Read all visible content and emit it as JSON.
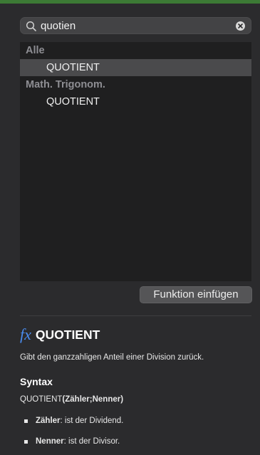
{
  "search": {
    "value": "quotien"
  },
  "results": {
    "groups": [
      {
        "category": "Alle",
        "items": [
          "QUOTIENT"
        ]
      },
      {
        "category": "Math. Trigonom.",
        "items": [
          "QUOTIENT"
        ]
      }
    ],
    "selected": "Alle/QUOTIENT"
  },
  "insert_button": {
    "label": "Funktion einfügen"
  },
  "help": {
    "fx_symbol": "fx",
    "function_name": "QUOTIENT",
    "description": "Gibt den ganzzahligen Anteil einer Division zurück.",
    "syntax_heading": "Syntax",
    "syntax_func": "QUOTIENT",
    "syntax_args": "(Zähler;Nenner)",
    "params": [
      {
        "name": "Zähler",
        "text": ": ist der Dividend."
      },
      {
        "name": "Nenner",
        "text": ": ist der Divisor."
      }
    ]
  },
  "colors": {
    "accent_fx": "#4a8df0",
    "top_bar": "#3c7a35"
  }
}
